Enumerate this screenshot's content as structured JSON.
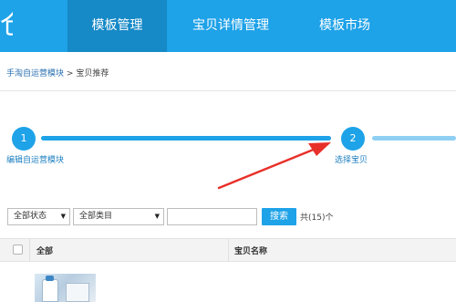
{
  "header": {
    "logo_fragment": "仓",
    "nav": [
      {
        "label": "模板管理",
        "active": true
      },
      {
        "label": "宝贝详情管理",
        "active": false
      },
      {
        "label": "模板市场",
        "active": false
      }
    ]
  },
  "breadcrumb": {
    "link": "手淘自运营模块",
    "separator": ">",
    "current": "宝贝推荐"
  },
  "steps": [
    {
      "number": "1",
      "label": "编辑自运营模块"
    },
    {
      "number": "2",
      "label": "选择宝贝"
    }
  ],
  "filters": {
    "status_selected": "全部状态",
    "category_selected": "全部类目",
    "search_value": "",
    "search_button": "搜索",
    "count_text": "共(15)个"
  },
  "table": {
    "columns": [
      "全部",
      "宝贝名称"
    ]
  },
  "annotation": {
    "arrow_color": "#e8302a"
  },
  "colors": {
    "primary": "#1ea2e8",
    "nav_active": "#1689c7"
  }
}
